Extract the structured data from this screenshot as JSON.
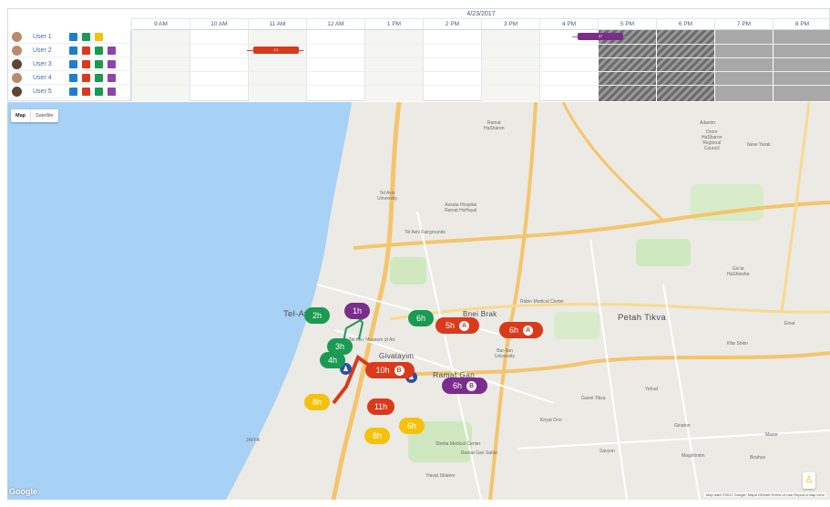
{
  "scheduler": {
    "date": "4/23/2017",
    "hours": [
      "9 AM",
      "10 AM",
      "11 AM",
      "12 AM",
      "1 PM",
      "2 PM",
      "3 PM",
      "4 PM",
      "5 PM",
      "6 PM",
      "7 PM",
      "8 PM"
    ],
    "users": [
      {
        "name": "User 1",
        "colors": [
          "#1e7fc8",
          "#1a9a52",
          "#f4c20d"
        ]
      },
      {
        "name": "User 2",
        "colors": [
          "#1e7fc8",
          "#d93a1c",
          "#1a9a52",
          "#8e44ad"
        ]
      },
      {
        "name": "User 3",
        "colors": [
          "#1e7fc8",
          "#d93a1c",
          "#1a9a52",
          "#8e44ad"
        ]
      },
      {
        "name": "User 4",
        "colors": [
          "#1e7fc8",
          "#d93a1c",
          "#1a9a52",
          "#8e44ad"
        ]
      },
      {
        "name": "User 5",
        "colors": [
          "#1e7fc8",
          "#d93a1c",
          "#1a9a52",
          "#8e44ad"
        ]
      }
    ],
    "events": [
      {
        "user": "User 1",
        "label": "37",
        "color": "#7b2d8e"
      },
      {
        "user": "User 2",
        "label": "C1",
        "color": "#d93a1c"
      }
    ]
  },
  "map": {
    "toggle": {
      "map": "Map",
      "satellite": "Satellite"
    },
    "cities": {
      "tel_aviv": "Tel-Aviv",
      "petah_tikva": "Petah Tikva",
      "bnei_brak": "Bnei Brak",
      "ramat_gan": "Ramat Gan",
      "givatayim": "Givatayim"
    },
    "places": {
      "ramat_hasharon": "Ramat\nHaSharon",
      "adanim": "Adanim",
      "drom_hasharon": "Drom\nHaSharon\nRegional\nCouncil",
      "neve_yarak": "Neve Yarak",
      "tel_aviv_university": "Tel Aviv\nUniversity",
      "assuta": "Assuta Hospital\nRamat HaHayal",
      "fairgrounds": "Tel Aviv Fairgrounds",
      "givat_hashlosha": "Giv'at\nHaShlosha",
      "rabin": "Rabin Medical Center",
      "museum": "Tel Aviv Museum of Art",
      "bar_ilan": "Bar-Ilan\nUniversity",
      "ganei_tikva": "Ganei Tikva",
      "kiryat_ono": "Kiryat Ono",
      "sheba": "Sheba Medical Center",
      "safari": "Ramat Gan Safari",
      "savyon": "Savyon",
      "magshimim": "Magshimim",
      "ginaton": "Ginaton",
      "kfar_sirkin": "Kfar Sirkin",
      "einat": "Einat",
      "yehud": "Yehud",
      "havat_shalem": "Havat Shalem",
      "jaffa": "JAFFA",
      "mazor": "Mazor",
      "birahya": "Birahya"
    },
    "pins": [
      {
        "label": "2h",
        "color": "#1a9a52"
      },
      {
        "label": "1h",
        "color": "#7b2d8e"
      },
      {
        "label": "6h",
        "color": "#1a9a52"
      },
      {
        "label": "5h",
        "color": "#d93a1c",
        "tag": "A"
      },
      {
        "label": "6h",
        "color": "#d93a1c",
        "tag": "A"
      },
      {
        "label": "3h",
        "color": "#1a9a52"
      },
      {
        "label": "4h",
        "color": "#1a9a52"
      },
      {
        "label": "10h",
        "color": "#d93a1c",
        "tag": "B"
      },
      {
        "label": "6h",
        "color": "#7b2d8e",
        "tag": "B"
      },
      {
        "label": "8h",
        "color": "#f4c20d"
      },
      {
        "label": "11h",
        "color": "#d93a1c"
      },
      {
        "label": "6h",
        "color": "#f4c20d"
      },
      {
        "label": "8h",
        "color": "#f4c20d"
      }
    ],
    "google": "Google",
    "attribution": "Map data ©2017 Google, Mapa GISrael   Terms of Use   Report a map error",
    "colors": {
      "water": "#a7d1f5",
      "land": "#eceae4",
      "highway": "#f4c56c"
    }
  }
}
